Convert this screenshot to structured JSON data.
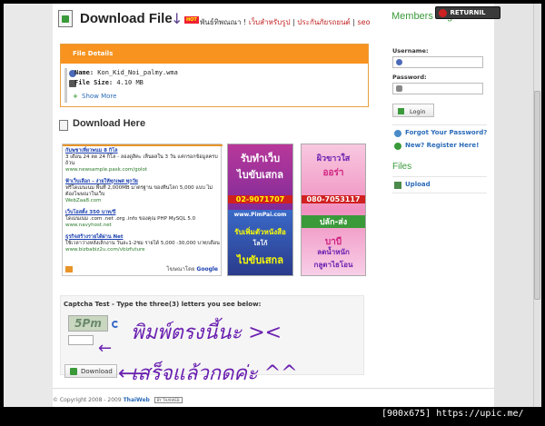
{
  "header": {
    "title": "Download File",
    "hot_badge": "HOT",
    "links_prefix": "พันธ์ทิพณณา !",
    "link1": "เว็บสำหรับรูป",
    "sep1": " | ",
    "link2": "ประกันภัยรถยนต์",
    "sep2": " | ",
    "link3": "seo"
  },
  "file_details": {
    "heading": "File Details",
    "name_label": "Name:",
    "name_value": "Kon_Kid_Noi_palmy.wma",
    "size_label": "File Size:",
    "size_value": "4.10 MB",
    "show_more": "Show More"
  },
  "download_here": {
    "title": "Download Here"
  },
  "ads": {
    "text_ads": [
      {
        "title": "กัมพูชาเที่ยวพนม 8 กิโล",
        "body": "3 เดือน 24 ลด 24 กิโล - ลองดูสิคะ เห็นผลใน 3 วัน แค่กรอกข้อมูลครบถ้วน",
        "url": "www.newsample.pask.com/golot"
      },
      {
        "title": "ฟ้าเว็บเลือก - ง่ายให้ทุกเพศ ทุกวัย",
        "body": "ฟรีโดเมนเนม พื้นที่ 2,000MB มาตรฐาน ของทีนโลก 5,000 แบบ ไม่ต้องโฆษณาในเว็บ",
        "url": "WebZaa8.com"
      },
      {
        "title": "เว็บโฮสติ้ง 350 บาท/ปี",
        "body": "โดเมนเนม .com .net .org .info ของคุณ PHP MySQL 5.0",
        "url": "www.navyhost.net"
      },
      {
        "title": "ธุรกิจสร้างรายได้ผ่าน Net",
        "body": "ใช้เวลาว่างหลังเลิกงาน วันละ1-2ชม รายได้ 5,000 -30,000 บาท/เดือน",
        "url": "www.bizbabiz2u.com/vbizfuture"
      }
    ],
    "google_label": "โฆษณาโดย",
    "google_brand": "Google",
    "banner1": {
      "line1": "รับทำเว็บ",
      "line2": "ไบขับเสกล",
      "phone": "02-9071707",
      "site": "www.PimPai.com",
      "line3": "รับเพิ่มตัวหนังสือ",
      "line4": "โลโก้",
      "line5": "ไบขับเสกล"
    },
    "banner2": {
      "line1": "ผิวขาวใส",
      "line2": "ออร่า",
      "phone": "080-7053117",
      "line3": "ปลัก-ส่ง",
      "line4": "บาบี",
      "line5": "ลดน้ำหนัก",
      "line6": "กลูตาไธโอน"
    }
  },
  "captcha": {
    "label": "Captcha Test - Type the three(3) letters you see below:",
    "image_text": "5Pm",
    "input_value": "",
    "button_label": "Download"
  },
  "annotations": {
    "line1": "พิมพ์ตรงนี้นะ ><",
    "line2": "เสร็จแล้วกดค่ะ ^^"
  },
  "footer": {
    "copyright": "© Copyright 2008 - 2009",
    "brand": "ThaiWeb",
    "badge": "BY THAIWEB"
  },
  "sidebar": {
    "members_title": "Members Login",
    "returnil": "RETURNIL",
    "username_label": "Username:",
    "password_label": "Password:",
    "login_button": "Login",
    "forgot_link": "Forgot Your Password?",
    "register_link": "New? Register Here!",
    "files_title": "Files",
    "upload_link": "Upload"
  },
  "watermark": "[900x675] https://upic.me/"
}
